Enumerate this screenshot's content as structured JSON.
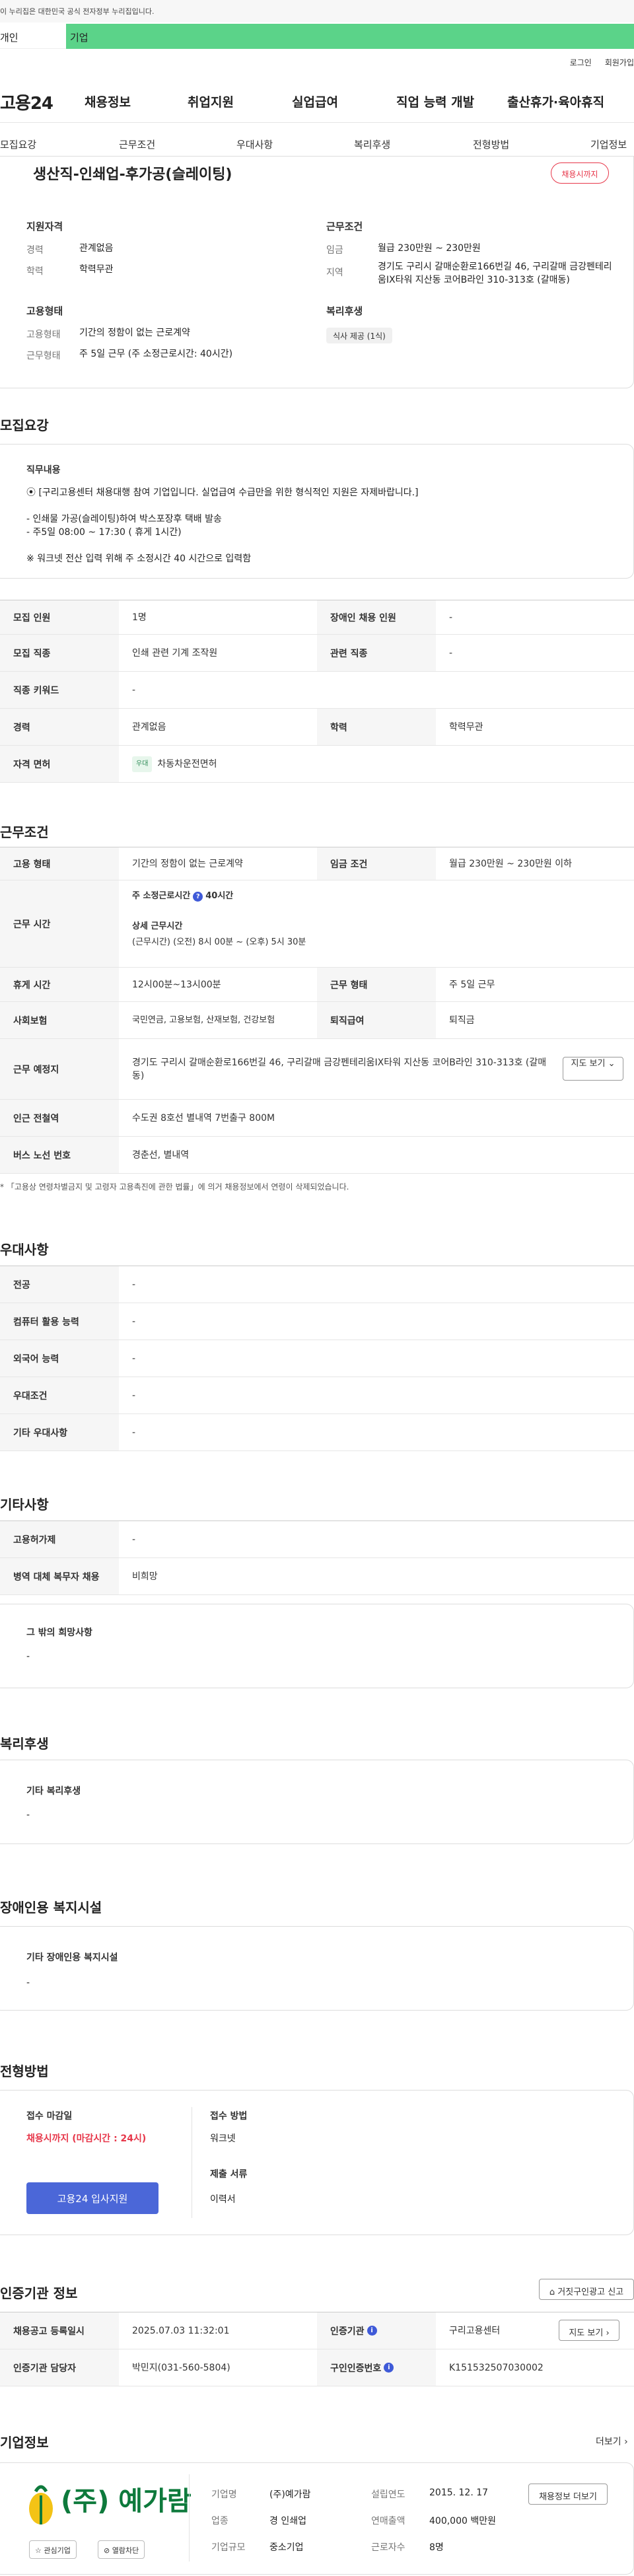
{
  "header": {
    "gov_notice": "이 누리집은 대한민국 공식 전자정부 누리집입니다.",
    "tab_personal": "개인",
    "tab_company": "기업",
    "util_links": [
      "로그인",
      "회원가입"
    ],
    "logo": "고용24",
    "gnb": [
      "채용정보",
      "취업지원",
      "실업급여",
      "직업 능력 개발",
      "출산휴가·육아휴직"
    ]
  },
  "anchor_nav": [
    "모집요강",
    "근무조건",
    "우대사항",
    "복리후생",
    "전형방법",
    "기업정보"
  ],
  "summary": {
    "title": "생산직-인쇄업-후가공(슬레이팅)",
    "badge": "채용시까지",
    "qual_head": "지원자격",
    "career_key": "경력",
    "career_val": "관계없음",
    "edu_key": "학력",
    "edu_val": "학력무관",
    "cond_head": "근무조건",
    "wage_key": "임금",
    "wage_val": "월급 230만원 ~ 230만원",
    "region_key": "지역",
    "region_val": "경기도 구리시 갈매순환로166번길 46, 구리갈매 금강펜테리움IX타워 지산동 코어B라인 310-313호 (갈매동)",
    "type_head": "고용형태",
    "emp_key": "고용형태",
    "emp_val": "기간의 정함이 없는 근로계약",
    "work_key": "근무형태",
    "work_val": "주 5일 근무 (주 소정근로시간: 40시간)",
    "welfare_head": "복리후생",
    "welfare_tag": "식사 제공 (1식)"
  },
  "recruit": {
    "title": "모집요강",
    "duty_head": "직무내용",
    "duty_lines": [
      "⦿ [구리고용센터 채용대행 참여 기업입니다. 실업급여 수급만을 위한 형식적인 지원은 자제바랍니다.]",
      "- 인쇄물 가공(슬레이팅)하여 박스포장후 택배 발송",
      "- 주5일 08:00 ~ 17:30  ( 휴게 1시간)",
      "※ 워크넷 전산 입력 위해 주 소정시간 40 시간으로 입력함"
    ],
    "rows": [
      {
        "k1": "모집 인원",
        "v1": "1명",
        "k2": "장애인 채용 인원",
        "v2": "-"
      },
      {
        "k1": "모집 직종",
        "v1": "인쇄 관련 기계 조작원",
        "k2": "관련 직종",
        "v2": "-"
      },
      {
        "k1": "직종 키워드",
        "v1": "-"
      },
      {
        "k1": "경력",
        "v1": "관계없음",
        "k2": "학력",
        "v2": "학력무관"
      },
      {
        "k1": "자격 면허",
        "chip": "우대",
        "v1": "차동차운전면허"
      }
    ]
  },
  "conditions": {
    "title": "근무조건",
    "emp_type_k": "고용 형태",
    "emp_type_v": "기간의 정함이 없는 근로계약",
    "wage_k": "임금 조건",
    "wage_v": "월급 230만원 ~ 230만원 이하",
    "hours_k": "근무 시간",
    "hours_main_label": "주 소정근로시간",
    "hours_main_val": "40시간",
    "hours_detail_label": "상세 근무시간",
    "hours_detail_val": "(근무시간) (오전) 8시 00분 ~ (오후) 5시 30분",
    "break_k": "휴게 시간",
    "break_v": "12시00분~13시00분",
    "work_form_k": "근무 형태",
    "work_form_v": "주 5일 근무",
    "insurance_k": "사회보험",
    "insurance_v": "국민연금, 고용보험, 산재보험, 건강보험",
    "retire_k": "퇴직급여",
    "retire_v": "퇴직금",
    "place_k": "근무 예정지",
    "place_v": "경기도 구리시 갈매순환로166번길 46, 구리갈매 금강펜테리움IX타워 지산동 코어B라인 310-313호 (갈매동)",
    "map_btn": "지도 보기",
    "subway_k": "인근 전철역",
    "subway_v": "수도권 8호선 별내역 7번출구 800M",
    "bus_k": "버스 노선 번호",
    "bus_v": "경춘선, 별내역",
    "note": "* 「고용상 연령차별금지 및 고령자 고용촉진에 관한 법률」에 의거 채용정보에서 연령이 삭제되었습니다."
  },
  "preference": {
    "title": "우대사항",
    "rows": [
      {
        "k": "전공",
        "v": "-"
      },
      {
        "k": "컴퓨터 활용 능력",
        "v": "-"
      },
      {
        "k": "외국어 능력",
        "v": "-"
      },
      {
        "k": "우대조건",
        "v": "-"
      },
      {
        "k": "기타 우대사항",
        "v": "-"
      }
    ]
  },
  "etc": {
    "title": "기타사항",
    "rows": [
      {
        "k": "고용허가제",
        "v": "-"
      },
      {
        "k": "병역 대체 복무자 채용",
        "v": "비희망"
      }
    ],
    "box_head": "그 밖의 희망사항",
    "box_val": "-"
  },
  "welfare": {
    "title": "복리후생",
    "box_head": "기타 복리후생",
    "box_val": "-"
  },
  "disabled": {
    "title": "장애인용 복지시설",
    "box_head": "기타 장애인용 복지시설",
    "box_val": "-"
  },
  "selection": {
    "title": "전형방법",
    "deadline_head": "접수 마감일",
    "deadline_val": "채용시까지 (마감시간 : 24시)",
    "apply_btn": "고용24 입사지원",
    "method_head": "접수 방법",
    "method_val": "워크넷",
    "docs_head": "제출 서류",
    "docs_val": "이력서"
  },
  "agency": {
    "title": "인증기관 정보",
    "report_btn": "거짓구인광고 신고",
    "reg_k": "채용공고 등록일시",
    "reg_v": "2025.07.03 11:32:01",
    "agency_k": "인증기관",
    "agency_v": "구리고용센터",
    "map_btn": "지도 보기",
    "manager_k": "인증기관 담당자",
    "manager_v": "박민지(031-560-5804)",
    "num_k": "구인인증번호",
    "num_v": "K151532507030002"
  },
  "company": {
    "title": "기업정보",
    "more": "더보기",
    "logo_text": "(주) 예가람",
    "fav_btn": "관심기업",
    "block_btn": "열람차단",
    "name_k": "기업명",
    "name_v": "(주)예가람",
    "industry_k": "업종",
    "industry_v": "경 인쇄업",
    "scale_k": "기업규모",
    "scale_v": "중소기업",
    "founded_k": "설립연도",
    "founded_v": "2015. 12. 17",
    "sales_k": "연매출액",
    "sales_v": "400,000 백만원",
    "staff_k": "근로자수",
    "staff_v": "8명",
    "jobs_btn": "채용정보 더보기"
  },
  "colors": {
    "accent": "#4b67d8",
    "company_tab": "#5bd389",
    "deadline": "#e7374a"
  }
}
